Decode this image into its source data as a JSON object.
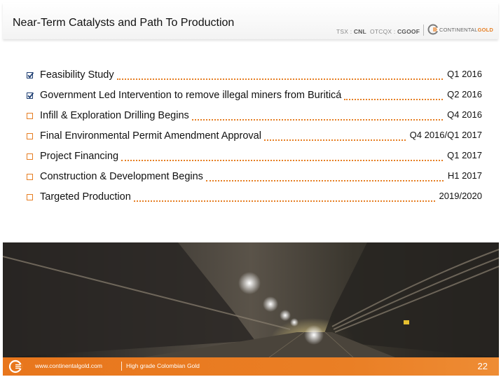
{
  "header": {
    "title": "Near-Term Catalysts and Path To Production",
    "tsx_label": "TSX : ",
    "tsx_value": "CNL",
    "otc_label": "OTCQX : ",
    "otc_value": "CGOOF",
    "logo_text_1": "CONTINENTAL",
    "logo_text_2": "GOLD"
  },
  "items": [
    {
      "label": "Feasibility Study",
      "date": "Q1 2016",
      "checked": true
    },
    {
      "label": "Government Led Intervention to remove illegal miners from Buriticá",
      "date": "Q2 2016",
      "checked": true
    },
    {
      "label": "Infill & Exploration Drilling Begins",
      "date": "Q4 2016",
      "checked": false
    },
    {
      "label": "Final Environmental Permit Amendment Approval",
      "date": "Q4 2016/Q1 2017",
      "checked": false
    },
    {
      "label": "Project Financing",
      "date": "Q1 2017",
      "checked": false
    },
    {
      "label": "Construction & Development Begins",
      "date": "H1 2017",
      "checked": false
    },
    {
      "label": "Targeted Production",
      "date": "2019/2020",
      "checked": false
    }
  ],
  "footer": {
    "url": "www.continentalgold.com",
    "tagline": "High grade Colombian Gold",
    "page_number": "22"
  },
  "colors": {
    "accent_orange": "#e67e22",
    "checkbox_blue": "#1f3f73"
  },
  "icons": {
    "checked": "checked-checkbox-icon",
    "unchecked": "empty-checkbox-icon",
    "logo": "continental-gold-logo-icon"
  }
}
